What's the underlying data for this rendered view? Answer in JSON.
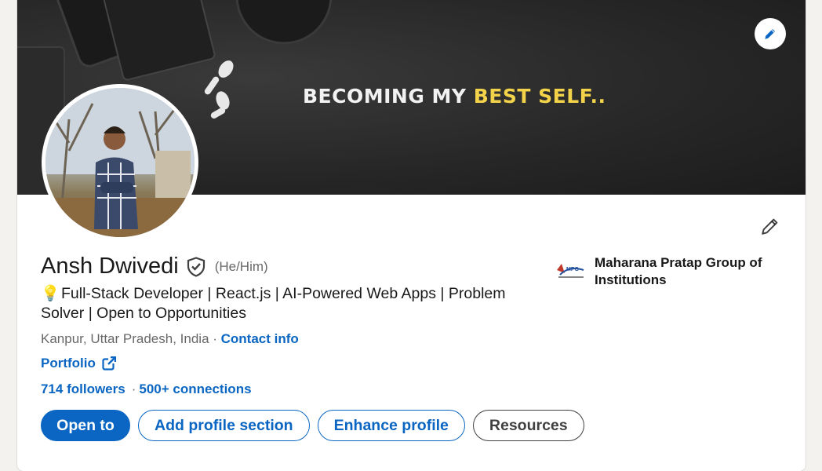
{
  "banner": {
    "text_part1": "BECOMING MY ",
    "text_highlight": "BEST SELF..",
    "highlight_color": "#f3d34a",
    "edit_icon": "pencil-icon"
  },
  "profile": {
    "name": "Ansh Dwivedi",
    "verified_icon": "verified-shield-icon",
    "pronouns": "(He/Him)",
    "headline_icon": "💡",
    "headline": "Full-Stack Developer | React.js | AI-Powered Web Apps | Problem Solver | Open to Opportunities",
    "location": "Kanpur, Uttar Pradesh, India",
    "location_sep": " · ",
    "contact_info": "Contact info",
    "portfolio": "Portfolio",
    "followers": "714 followers",
    "stats_sep": "·",
    "connections": "500+ connections"
  },
  "education": {
    "logo_text": "MPG",
    "name": "Maharana Pratap Group of Institutions"
  },
  "actions": {
    "open_to": "Open to",
    "add_section": "Add profile section",
    "enhance": "Enhance profile",
    "resources": "Resources"
  },
  "colors": {
    "accent": "#0a66c2",
    "background": "#f4f2ee"
  }
}
